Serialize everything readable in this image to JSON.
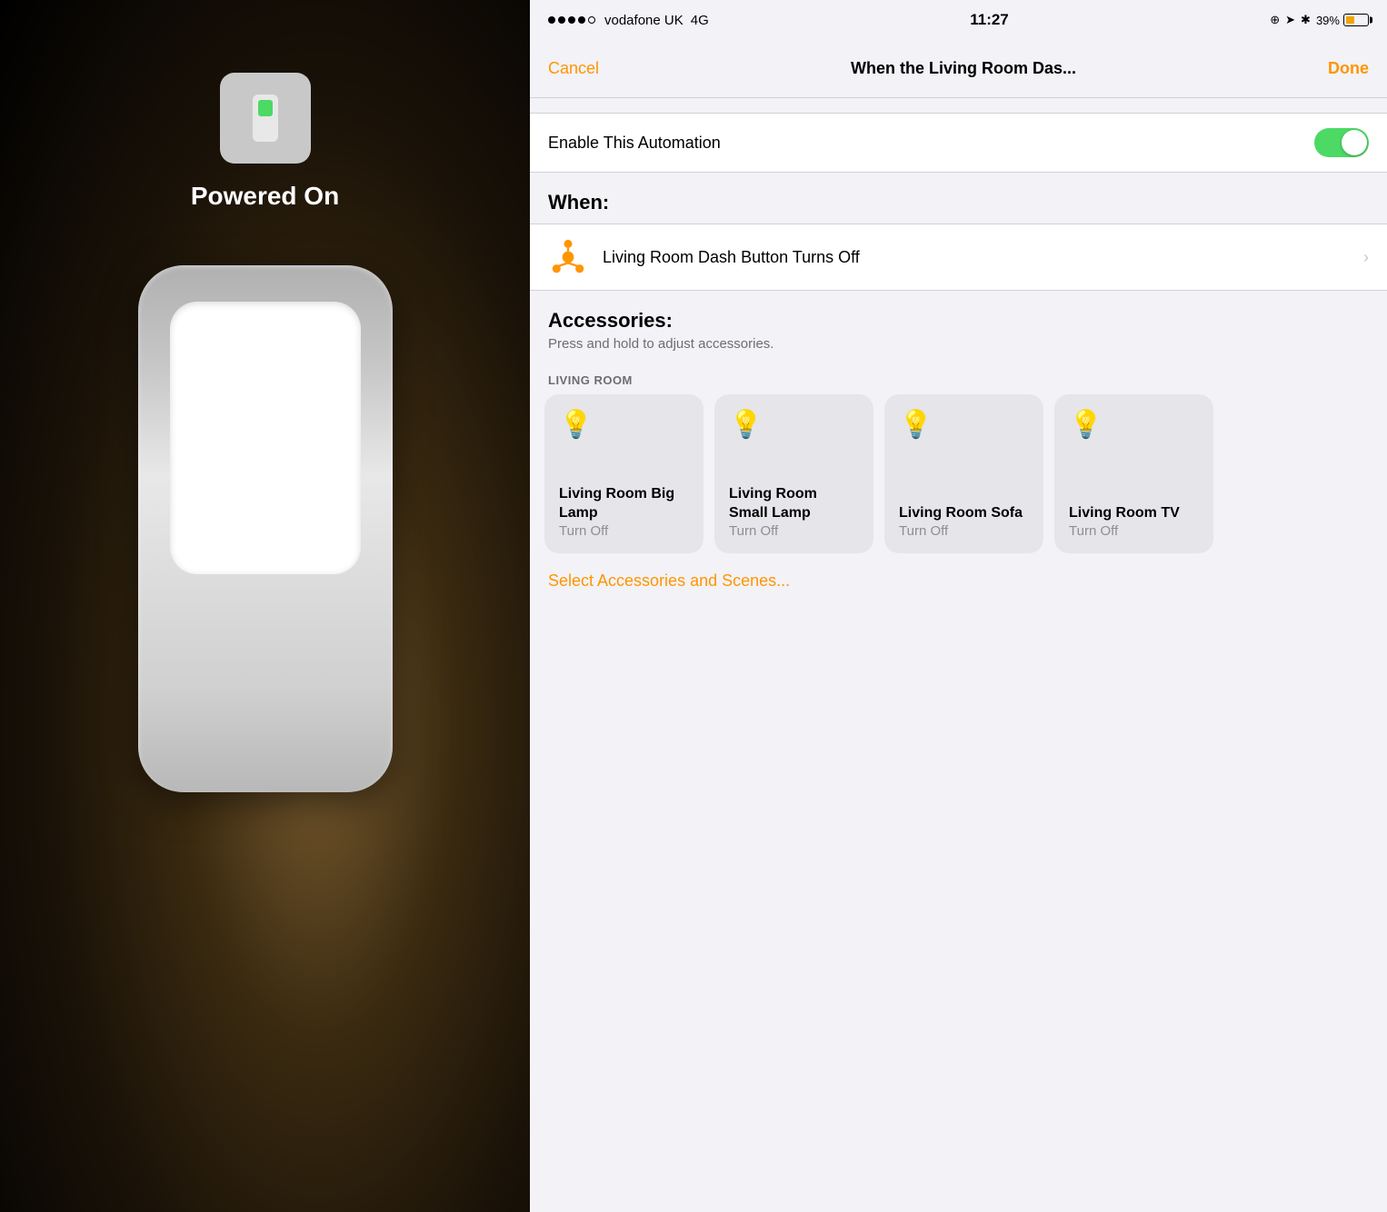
{
  "left": {
    "icon_label": "Powered On",
    "status": "on"
  },
  "right": {
    "status_bar": {
      "signal": "●●●●○",
      "carrier": "vodafone UK",
      "network": "4G",
      "time": "11:27",
      "battery_percent": "39%"
    },
    "nav": {
      "cancel": "Cancel",
      "title": "When the Living Room Das...",
      "done": "Done"
    },
    "enable": {
      "label": "Enable This Automation",
      "toggled": true
    },
    "when_section": {
      "header": "When:",
      "trigger": "Living Room Dash Button Turns Off"
    },
    "accessories_section": {
      "title": "Accessories:",
      "subtitle": "Press and hold to adjust accessories.",
      "room_label": "LIVING ROOM",
      "items": [
        {
          "name": "Living Room Big Lamp",
          "status": "Turn Off"
        },
        {
          "name": "Living Room Small Lamp",
          "status": "Turn Off"
        },
        {
          "name": "Living Room Sofa",
          "status": "Turn Off"
        },
        {
          "name": "Living Room TV",
          "status": "Turn Off"
        }
      ],
      "select_label": "Select Accessories and Scenes..."
    }
  }
}
